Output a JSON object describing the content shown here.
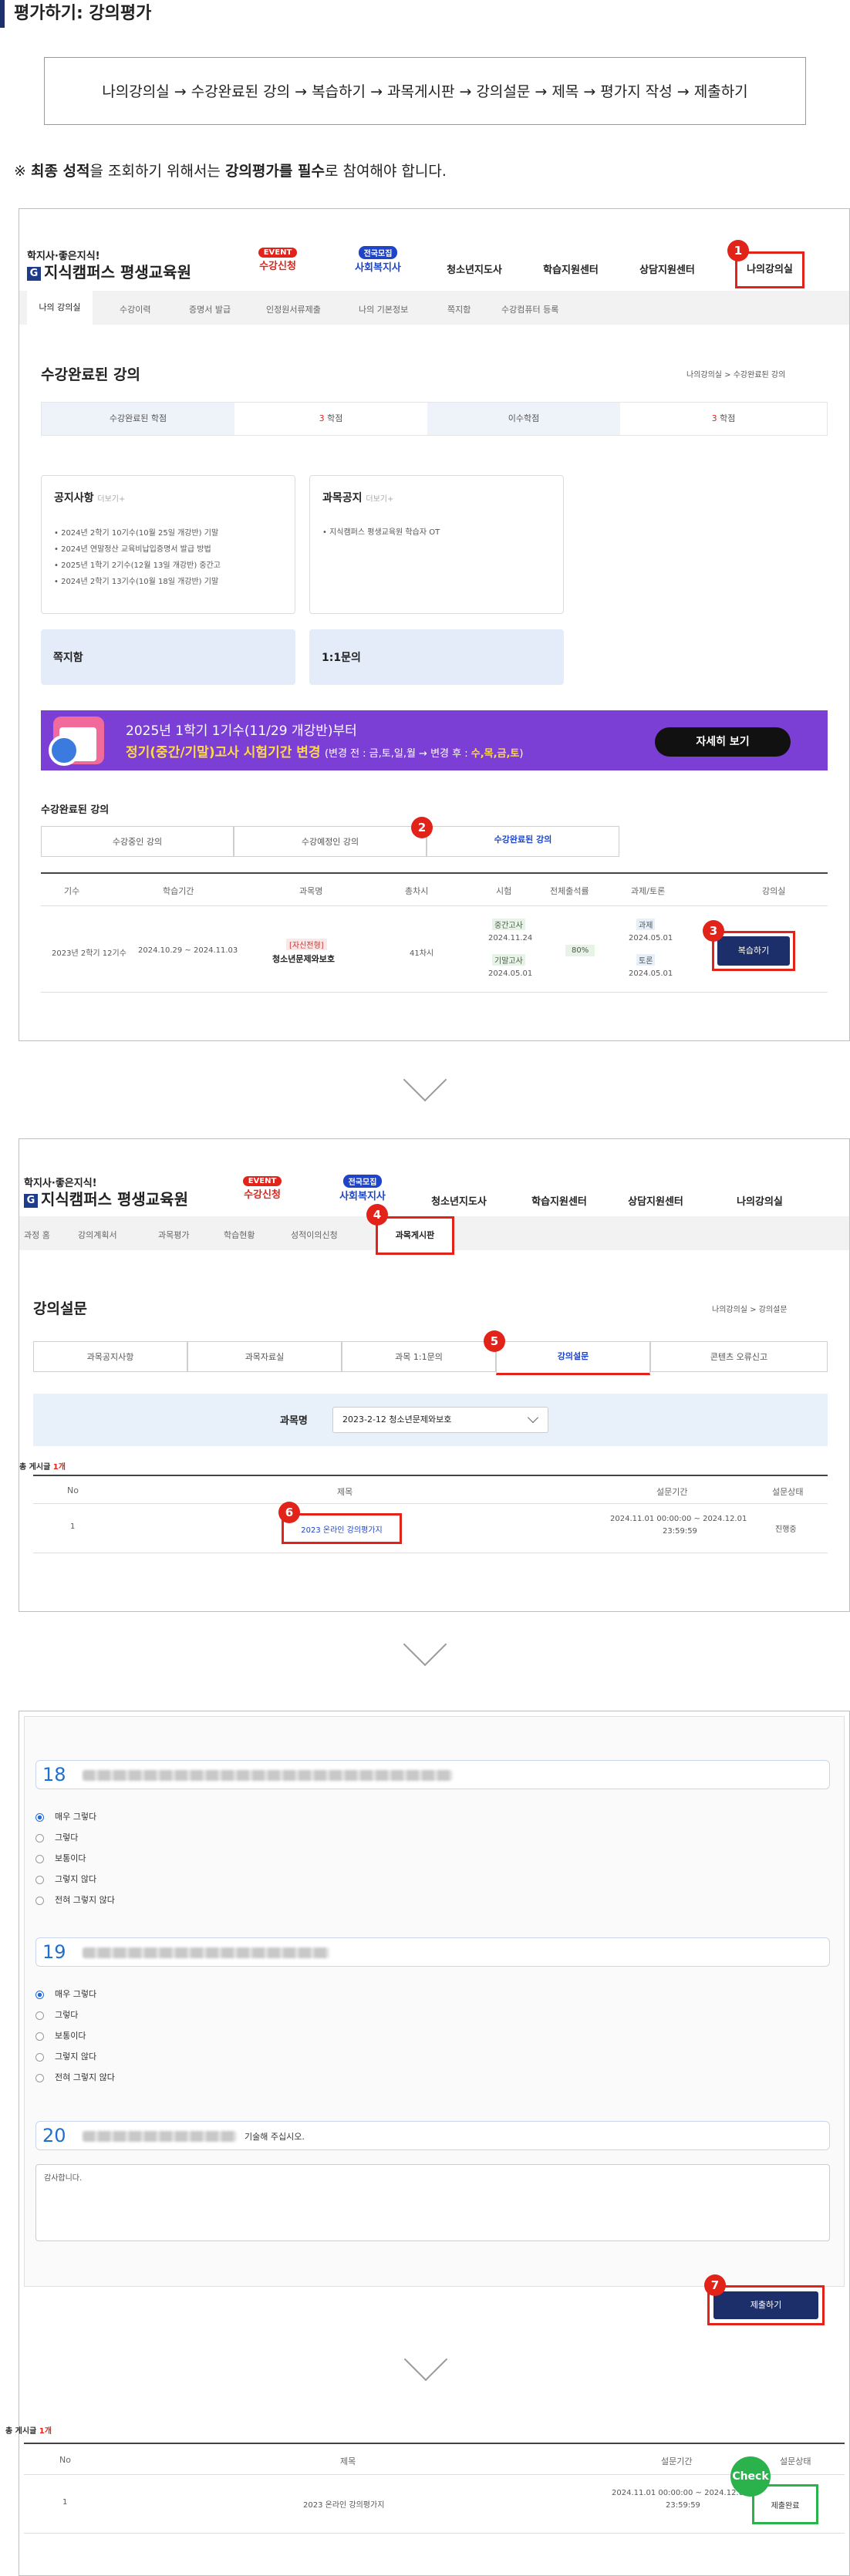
{
  "page": {
    "title": "평가하기: 강의평가",
    "steps": "나의강의실 → 수강완료된 강의 → 복습하기 → 과목게시판 → 강의설문 → 제목 → 평가지 작성 → 제출하기",
    "note_prefix": "※",
    "note_bold1": "최종 성적",
    "note_mid": "을 조회하기 위해서는 ",
    "note_bold2": "강의평가를 필수",
    "note_end": "로 참여해야 합니다."
  },
  "header": {
    "tagline": "학지사·좋은지식!",
    "logo_g": "G",
    "logo_text": "지식캠퍼스 평생교육원",
    "nav": [
      {
        "badge": "EVENT",
        "label": "수강신청"
      },
      {
        "badge": "전국모집",
        "label": "사회복지사"
      },
      {
        "label": "청소년지도사"
      },
      {
        "label": "학습지원센터"
      },
      {
        "label": "상담지원센터"
      },
      {
        "label": "나의강의실"
      }
    ]
  },
  "panel1": {
    "subnav": [
      "나의 강의실",
      "수강이력",
      "증명서 발급",
      "인정원서류제출",
      "나의 기본정보",
      "쪽지함",
      "수강컴퓨터 등록"
    ],
    "section_title": "수강완료된 강의",
    "breadcrumb": "나의강의실 > 수강완료된 강의",
    "credits": {
      "label1": "수강완료된 학점",
      "value1": "3",
      "unit": "학점",
      "label2": "이수학점",
      "value2": "3"
    },
    "notice": {
      "title": "공지사항",
      "more": "더보기+",
      "items": [
        "2024년 2학기 10기수(10월 25일 개강반) 기말",
        "2024년 연말정산 교육비납입증명서 발급 방법",
        "2025년 1학기 2기수(12월 13일 개강반) 중간고",
        "2024년 2학기 13기수(10월 18일 개강반) 기말"
      ]
    },
    "course_notice": {
      "title": "과목공지",
      "more": "더보기+",
      "items": [
        "지식캠퍼스 평생교육원 학습자 OT"
      ]
    },
    "memo": "쪽지함",
    "qna": "1:1문의",
    "banner": {
      "line1": "2025년 1학기 1기수(11/29 개강반)부터",
      "line2_a": "정기(중간/기말)고사 시험기간 변경",
      "line2_b": "(변경 전 : 금,토,일,월 → 변경 후 : ",
      "line2_c": "수,목,금,토",
      "line2_d": ")",
      "button": "자세히 보기"
    },
    "list_title": "수강완료된 강의",
    "tabs": [
      "수강중인 강의",
      "수강예정인 강의",
      "수강완료된 강의"
    ],
    "table_headers": [
      "기수",
      "학습기간",
      "과목명",
      "총차시",
      "시험",
      "전체출석률",
      "과제/토론",
      "강의실"
    ],
    "row": {
      "term": "2023년 2학기 12기수",
      "period": "2024.10.29 ~ 2024.11.03",
      "tag": "[자신전형]",
      "course": "청소년문제와보호",
      "sessions": "41차시",
      "exam1": "중간고사",
      "exam1_date": "2024.11.24",
      "exam2": "기말고사",
      "exam2_date": "2024.05.01",
      "attendance": "80%",
      "task1": "과제",
      "task1_date": "2024.05.01",
      "task2": "토론",
      "task2_date": "2024.05.01",
      "button": "복습하기"
    }
  },
  "panel2": {
    "subnav": [
      "과정 홈",
      "강의계획서",
      "과목평가",
      "학습현황",
      "성적이의신청",
      "과목게시판"
    ],
    "section_title": "강의설문",
    "breadcrumb": "나의강의실 > 강의설문",
    "tabs": [
      "과목공지사항",
      "과목자료실",
      "과목 1:1문의",
      "강의설문",
      "콘텐츠 오류신고"
    ],
    "course_label": "과목명",
    "course_value": "2023-2-12 청소년문제와보호",
    "total_label": "총 게시글",
    "total_count": "1개",
    "headers": [
      "No",
      "제목",
      "설문기간",
      "설문상태"
    ],
    "row": {
      "no": "1",
      "title": "2023 온라인 강의평가지",
      "period_a": "2024.11.01 00:00:00 ~ 2024.12.01",
      "period_b": "23:59:59",
      "status": "진행중"
    }
  },
  "panel3": {
    "questions": [
      {
        "num": "18",
        "options": [
          "매우 그렇다",
          "그렇다",
          "보통이다",
          "그렇지 않다",
          "전혀 그렇지 않다"
        ]
      },
      {
        "num": "19",
        "options": [
          "매우 그렇다",
          "그렇다",
          "보통이다",
          "그렇지 않다",
          "전혀 그렇지 않다"
        ]
      }
    ],
    "q20_num": "20",
    "q20_suffix": "기술해 주십시오.",
    "answer": "감사합니다.",
    "submit": "제출하기"
  },
  "result": {
    "total_label": "총 게시글",
    "total_count": "1개",
    "headers": [
      "No",
      "제목",
      "설문기간",
      "설문상태"
    ],
    "row": {
      "no": "1",
      "title": "2023 온라인 강의평가지",
      "period_a": "2024.11.01 00:00:00 ~ 2024.12.01",
      "period_b": "23:59:59",
      "status": "제출완료"
    },
    "check": "Check"
  },
  "markers": [
    "1",
    "2",
    "3",
    "4",
    "5",
    "6",
    "7"
  ],
  "colors": {
    "accent_red": "#e2231a",
    "navy": "#1c2f6b",
    "purple_banner": "#7b3fd6",
    "check_green": "#2bb24c"
  }
}
